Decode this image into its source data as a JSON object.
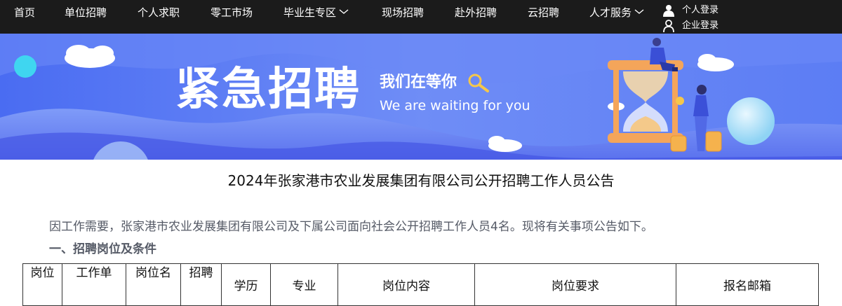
{
  "nav": {
    "items": [
      {
        "label": "首页",
        "dropdown": false
      },
      {
        "label": "单位招聘",
        "dropdown": false
      },
      {
        "label": "个人求职",
        "dropdown": false
      },
      {
        "label": "零工市场",
        "dropdown": false
      },
      {
        "label": "毕业生专区",
        "dropdown": true
      },
      {
        "label": "现场招聘",
        "dropdown": false
      },
      {
        "label": "赴外招聘",
        "dropdown": false
      },
      {
        "label": "云招聘",
        "dropdown": false
      },
      {
        "label": "人才服务",
        "dropdown": true
      }
    ],
    "personal_login": "个人登录",
    "company_login": "企业登录",
    "background": "#1b1b1b"
  },
  "banner": {
    "title": "紧急招聘",
    "subtitle_cn": "我们在等你",
    "subtitle_en": "We are waiting for you",
    "colors": {
      "base": "#5b7df4",
      "wave_light": "#8fa7f8",
      "wave_dark": "#4a5fe8",
      "accent": "#f5c74a"
    }
  },
  "article": {
    "title": "2024年张家港市农业发展集团有限公司公开招聘工作人员公告",
    "intro": "因工作需要，张家港市农业发展集团有限公司及下属公司面向社会公开招聘工作人员4名。现将有关事项公告如下。",
    "section_1": "一、招聘岗位及条件"
  },
  "table": {
    "headers": [
      {
        "line1": "岗位",
        "line2": ""
      },
      {
        "line1": "工作单",
        "line2": ""
      },
      {
        "line1": "岗位名",
        "line2": ""
      },
      {
        "line1": "招聘",
        "line2": ""
      },
      {
        "line1": "学历",
        "line2": ""
      },
      {
        "line1": "专业",
        "line2": ""
      },
      {
        "line1": "岗位内容",
        "line2": ""
      },
      {
        "line1": "岗位要求",
        "line2": ""
      },
      {
        "line1": "报名邮箱",
        "line2": ""
      }
    ]
  }
}
